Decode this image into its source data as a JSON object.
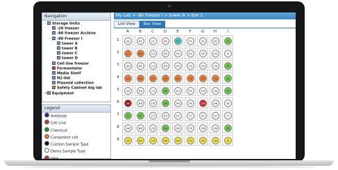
{
  "navigation": {
    "title": "Navigation",
    "tree": [
      {
        "label": "Storage Units",
        "level": 0,
        "toggle": "-",
        "icon": "storage-icon",
        "color": "#8899aa",
        "bold": true
      },
      {
        "label": "-20 freezer",
        "level": 1,
        "toggle": "",
        "icon": "freezer-icon",
        "color": "#6f8fcf",
        "bold": true
      },
      {
        "label": "-80 freezer Archive",
        "level": 1,
        "toggle": "",
        "icon": "freezer-icon",
        "color": "#6f8fcf",
        "bold": true
      },
      {
        "label": "-80 Freezer I",
        "level": 1,
        "toggle": "-",
        "icon": "freezer-icon",
        "color": "#6f8fcf",
        "bold": true
      },
      {
        "label": "tower A",
        "level": 2,
        "toggle": "",
        "icon": "tower-icon",
        "color": "#5fa0d8",
        "bold": true
      },
      {
        "label": "tower B",
        "level": 2,
        "toggle": "",
        "icon": "tower-icon",
        "color": "#5fa0d8",
        "bold": true
      },
      {
        "label": "tower C",
        "level": 2,
        "toggle": "",
        "icon": "tower-icon",
        "color": "#5fa0d8",
        "bold": true
      },
      {
        "label": "tower D",
        "level": 2,
        "toggle": "",
        "icon": "tower-icon",
        "color": "#5fa0d8",
        "bold": true
      },
      {
        "label": "Cell line freezer",
        "level": 1,
        "toggle": "",
        "icon": "freezer-icon",
        "color": "#6f8fcf",
        "bold": true
      },
      {
        "label": "Fermentator",
        "level": 1,
        "toggle": "",
        "icon": "fermentator-icon",
        "color": "#c0392b",
        "bold": true
      },
      {
        "label": "Media Shelf",
        "level": 1,
        "toggle": "",
        "icon": "shelf-icon",
        "color": "#6f8fcf",
        "bold": true
      },
      {
        "label": "N2-Vat",
        "level": 1,
        "toggle": "",
        "icon": "vat-icon",
        "color": "#6f8fcf",
        "bold": true
      },
      {
        "label": "Plasmid collection",
        "level": 1,
        "toggle": "",
        "icon": "collection-icon",
        "color": "#6f8fcf",
        "bold": true
      },
      {
        "label": "Safety Cabinet big lab",
        "level": 1,
        "toggle": "",
        "icon": "cabinet-icon",
        "color": "#b08850",
        "bold": true
      },
      {
        "label": "Equipment",
        "level": 0,
        "toggle": "+",
        "icon": "equipment-icon",
        "color": "#8899aa",
        "bold": true
      }
    ]
  },
  "legend": {
    "title": "Legend",
    "items": [
      {
        "label": "Antibody",
        "color": "#2a2a8a"
      },
      {
        "label": "Cell Line",
        "color": "#c0392b"
      },
      {
        "label": "Chemical",
        "color": "#2e8b2e"
      },
      {
        "label": "Competent cell",
        "color": "#e67e22"
      },
      {
        "label": "Custom Sample Type",
        "color": "#111111"
      },
      {
        "label": "Demo Sample Type",
        "color": "#ffffff"
      },
      {
        "label": "DNA",
        "color": "#c0392b"
      }
    ]
  },
  "breadcrumb": "My Lab > -80 Freezer I > tower A > box 1",
  "tabs": [
    {
      "label": "List View",
      "active": false
    },
    {
      "label": "Box View",
      "active": true
    }
  ],
  "box": {
    "columns": [
      "A",
      "B",
      "C",
      "D",
      "E",
      "F",
      "G",
      "H",
      "I"
    ],
    "rows": [
      "1",
      "2",
      "3",
      "4",
      "5",
      "6",
      "7",
      "8",
      "9"
    ],
    "wells": [
      [
        {
          "t": "A1",
          "c": "#f4f4f4"
        },
        {
          "t": "B1",
          "c": "#f4f4f4"
        },
        {
          "t": "C1",
          "c": "#f4f4f4"
        },
        {
          "t": "D1",
          "c": "#f4f4f4"
        },
        {
          "t": "E1",
          "c": "#48c2c8"
        },
        {
          "t": "F1",
          "c": "#f4f4f4"
        },
        {
          "t": "G1",
          "c": "#f4f4f4"
        },
        {
          "t": "H1",
          "c": "#f4f4f4"
        },
        {
          "t": "I1",
          "c": "#6cc64a"
        }
      ],
      [
        {
          "t": "A2",
          "c": "#ee7d33"
        },
        {
          "t": "B2",
          "c": "#ee7d33"
        },
        {
          "t": "C2",
          "c": "#f4f4f4"
        },
        {
          "t": "D2",
          "c": "#f4f4f4"
        },
        {
          "t": "E2",
          "c": "#f4f4f4"
        },
        {
          "t": "F2",
          "c": "#f4f4f4"
        },
        {
          "t": "G2",
          "c": "#f4f4f4"
        },
        {
          "t": "H2",
          "c": "#f4f4f4"
        },
        {
          "t": "I2",
          "c": "#f4f4f4"
        }
      ],
      [
        {
          "t": "A3",
          "c": "#f4f4f4"
        },
        {
          "t": "B3",
          "c": "#f4f4f4"
        },
        {
          "t": "C3",
          "c": "#f4f4f4"
        },
        {
          "t": "D3",
          "c": "#f4f4f4"
        },
        {
          "t": "E3",
          "c": "#f4f4f4"
        },
        {
          "t": "F3",
          "c": "#f4f4f4"
        },
        {
          "t": "G3",
          "c": "#f4f4f4"
        },
        {
          "t": "H3",
          "c": "#f4f4f4"
        },
        {
          "t": "I3",
          "c": "#6cc64a"
        }
      ],
      [
        {
          "t": "A4",
          "c": "#ee7d33"
        },
        {
          "t": "B4",
          "c": "#ee7d33"
        },
        {
          "t": "C4",
          "c": "#ee7d33"
        },
        {
          "t": "D4",
          "c": "#ee7d33"
        },
        {
          "t": "E4",
          "c": "#ee7d33"
        },
        {
          "t": "F4",
          "c": "#ee7d33"
        },
        {
          "t": "G4",
          "c": "#ee7d33"
        },
        {
          "t": "H4",
          "c": "#ee7d33"
        },
        {
          "t": "I4",
          "c": "#6cc64a"
        }
      ],
      [
        {
          "t": "A5",
          "c": "#f4f4f4"
        },
        {
          "t": "B5",
          "c": "#f4f4f4"
        },
        {
          "t": "C5",
          "c": "#f4f4f4"
        },
        {
          "t": "D5",
          "c": "#6cc64a"
        },
        {
          "t": "E5",
          "c": "#f4f4f4"
        },
        {
          "t": "F5",
          "c": "#f4f4f4"
        },
        {
          "t": "G5",
          "c": "#f4f4f4"
        },
        {
          "t": "H5",
          "c": "#f4f4f4"
        },
        {
          "t": "I5",
          "c": "#6cc64a"
        }
      ],
      [
        {
          "t": "A6",
          "c": "#a01818"
        },
        {
          "t": "B6",
          "c": "#f4f4f4"
        },
        {
          "t": "C6",
          "c": "#f4f4f4"
        },
        {
          "t": "D6",
          "c": "#6cc64a"
        },
        {
          "t": "E6",
          "c": "#f4f4f4"
        },
        {
          "t": "F6",
          "c": "#f4f4f4"
        },
        {
          "t": "G6",
          "c": "#cc2a2a"
        },
        {
          "t": "H6",
          "c": "#f4f4f4"
        },
        {
          "t": "I6",
          "c": "#f4f4f4"
        }
      ],
      [
        {
          "t": "A7",
          "c": "#6cc64a"
        },
        {
          "t": "B7",
          "c": "#6cc64a"
        },
        {
          "t": "C7",
          "c": "#f4f4f4"
        },
        {
          "t": "D7",
          "c": "#f4f4f4"
        },
        {
          "t": "E7",
          "c": "#f4f4f4"
        },
        {
          "t": "F7",
          "c": "#f4f4f4"
        },
        {
          "t": "G7",
          "c": "#f4f4f4"
        },
        {
          "t": "H7",
          "c": "#f4f4f4"
        },
        {
          "t": "I7",
          "c": "#f4f4f4"
        }
      ],
      [
        {
          "t": "A8",
          "c": "#f4f4f4"
        },
        {
          "t": "B8",
          "c": "#f4f4f4"
        },
        {
          "t": "C8",
          "c": "#f4f4f4"
        },
        {
          "t": "D8",
          "c": "#6cc64a"
        },
        {
          "t": "E8",
          "c": "#f4f4f4"
        },
        {
          "t": "F8",
          "c": "#f4f4f4"
        },
        {
          "t": "G8",
          "c": "#f4f4f4"
        },
        {
          "t": "H8",
          "c": "#f4f4f4"
        },
        {
          "t": "I8",
          "c": "#6cc64a"
        }
      ],
      [
        {
          "t": "A9",
          "c": "#f0e040"
        },
        {
          "t": "B9",
          "c": "#f0e040"
        },
        {
          "t": "C9",
          "c": "#f0e040"
        },
        {
          "t": "D9",
          "c": "#f0e040"
        },
        {
          "t": "E9",
          "c": "#f0e040"
        },
        {
          "t": "F9",
          "c": "#f0e040"
        },
        {
          "t": "G9",
          "c": "#f0e040"
        },
        {
          "t": "H9",
          "c": "#f0e040"
        },
        {
          "t": "I9",
          "c": "#f0e040"
        }
      ]
    ]
  }
}
